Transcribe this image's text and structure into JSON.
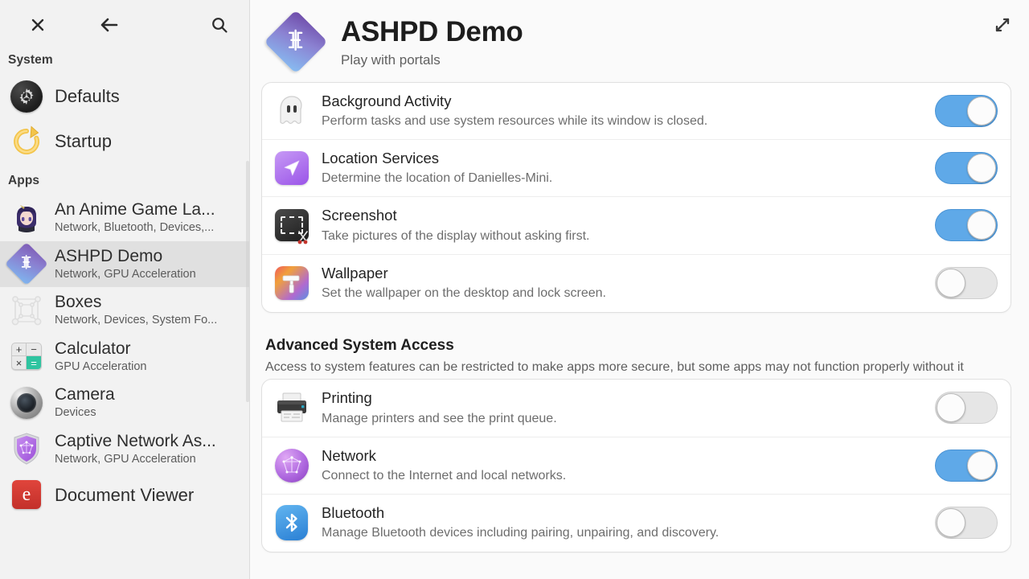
{
  "sidebar": {
    "header": {
      "close_label": "Close",
      "back_label": "Back",
      "search_label": "Search"
    },
    "groups": [
      {
        "title": "System",
        "items": [
          {
            "name": "Defaults",
            "sub": "",
            "icon": "defaults-icon"
          },
          {
            "name": "Startup",
            "sub": "",
            "icon": "startup-icon"
          }
        ]
      },
      {
        "title": "Apps",
        "items": [
          {
            "name": "An Anime Game La...",
            "sub": "Network, Bluetooth, Devices,...",
            "icon": "anime-game-launcher-icon"
          },
          {
            "name": "ASHPD Demo",
            "sub": "Network, GPU Acceleration",
            "icon": "ashpd-demo-icon",
            "selected": true
          },
          {
            "name": "Boxes",
            "sub": "Network, Devices, System Fo...",
            "icon": "boxes-icon"
          },
          {
            "name": "Calculator",
            "sub": "GPU Acceleration",
            "icon": "calculator-icon"
          },
          {
            "name": "Camera",
            "sub": "Devices",
            "icon": "camera-icon"
          },
          {
            "name": "Captive Network As...",
            "sub": "Network, GPU Acceleration",
            "icon": "captive-network-assistant-icon"
          },
          {
            "name": "Document Viewer",
            "sub": "",
            "icon": "document-viewer-icon"
          }
        ]
      }
    ]
  },
  "main": {
    "app_title": "ASHPD Demo",
    "app_subtitle": "Play with portals",
    "app_icon": "ashpd-demo-icon",
    "expand_label": "Expand",
    "permissions": [
      {
        "title": "Background Activity",
        "desc": "Perform tasks and use system resources while its window is closed.",
        "icon": "ghost-icon",
        "state": "on"
      },
      {
        "title": "Location Services",
        "desc": "Determine the location of Danielles-Mini.",
        "icon": "location-icon",
        "state": "on"
      },
      {
        "title": "Screenshot",
        "desc": "Take pictures of the display without asking first.",
        "icon": "screenshot-icon",
        "state": "on"
      },
      {
        "title": "Wallpaper",
        "desc": "Set the wallpaper on the desktop and lock screen.",
        "icon": "wallpaper-icon",
        "state": "off"
      }
    ],
    "advanced_section": {
      "title": "Advanced System Access",
      "desc": "Access to system features can be restricted to make apps more secure, but some apps may not function properly without it",
      "items": [
        {
          "title": "Printing",
          "desc": "Manage printers and see the print queue.",
          "icon": "printer-icon",
          "state": "off"
        },
        {
          "title": "Network",
          "desc": "Connect to the Internet and local networks.",
          "icon": "network-icon",
          "state": "on"
        },
        {
          "title": "Bluetooth",
          "desc": "Manage Bluetooth devices including pairing, unpairing, and discovery.",
          "icon": "bluetooth-icon",
          "state": "off"
        }
      ]
    }
  },
  "colors": {
    "toggle_on": "#5fa9e8",
    "toggle_off": "#e6e6e6",
    "sidebar_bg": "#f2f2f2",
    "sidebar_selected": "#e0e0e0",
    "main_bg": "#fafafa",
    "card_bg": "#ffffff"
  }
}
